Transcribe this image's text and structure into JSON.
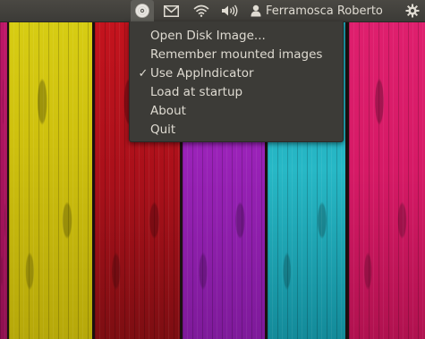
{
  "panel": {
    "indicators": [
      {
        "icon": "disc-icon"
      },
      {
        "icon": "mail-icon"
      },
      {
        "icon": "wifi-icon"
      },
      {
        "icon": "volume-icon"
      },
      {
        "icon": "user-icon"
      },
      {
        "icon": "gear-icon"
      }
    ],
    "user_name": "Ferramosca Roberto"
  },
  "menu": {
    "items": [
      {
        "label": "Open Disk Image...",
        "checked": false
      },
      {
        "label": "Remember mounted images",
        "checked": false
      },
      {
        "label": "Use AppIndicator",
        "checked": true,
        "check_glyph": "✓"
      },
      {
        "label": "Load at startup",
        "checked": false
      },
      {
        "label": "About",
        "checked": false
      },
      {
        "label": "Quit",
        "checked": false
      }
    ]
  },
  "colors": {
    "panel_bg": "#3c3b37",
    "menu_bg": "#3c3b37",
    "menu_text": "#dfdbd2",
    "active_indicator_bg": "#5e5d58"
  },
  "wallpaper": {
    "description_colors": [
      "#c2186a",
      "#d9cf14",
      "#c8141e",
      "#7a1fa6",
      "#1ba6b8",
      "#e0206f"
    ]
  }
}
